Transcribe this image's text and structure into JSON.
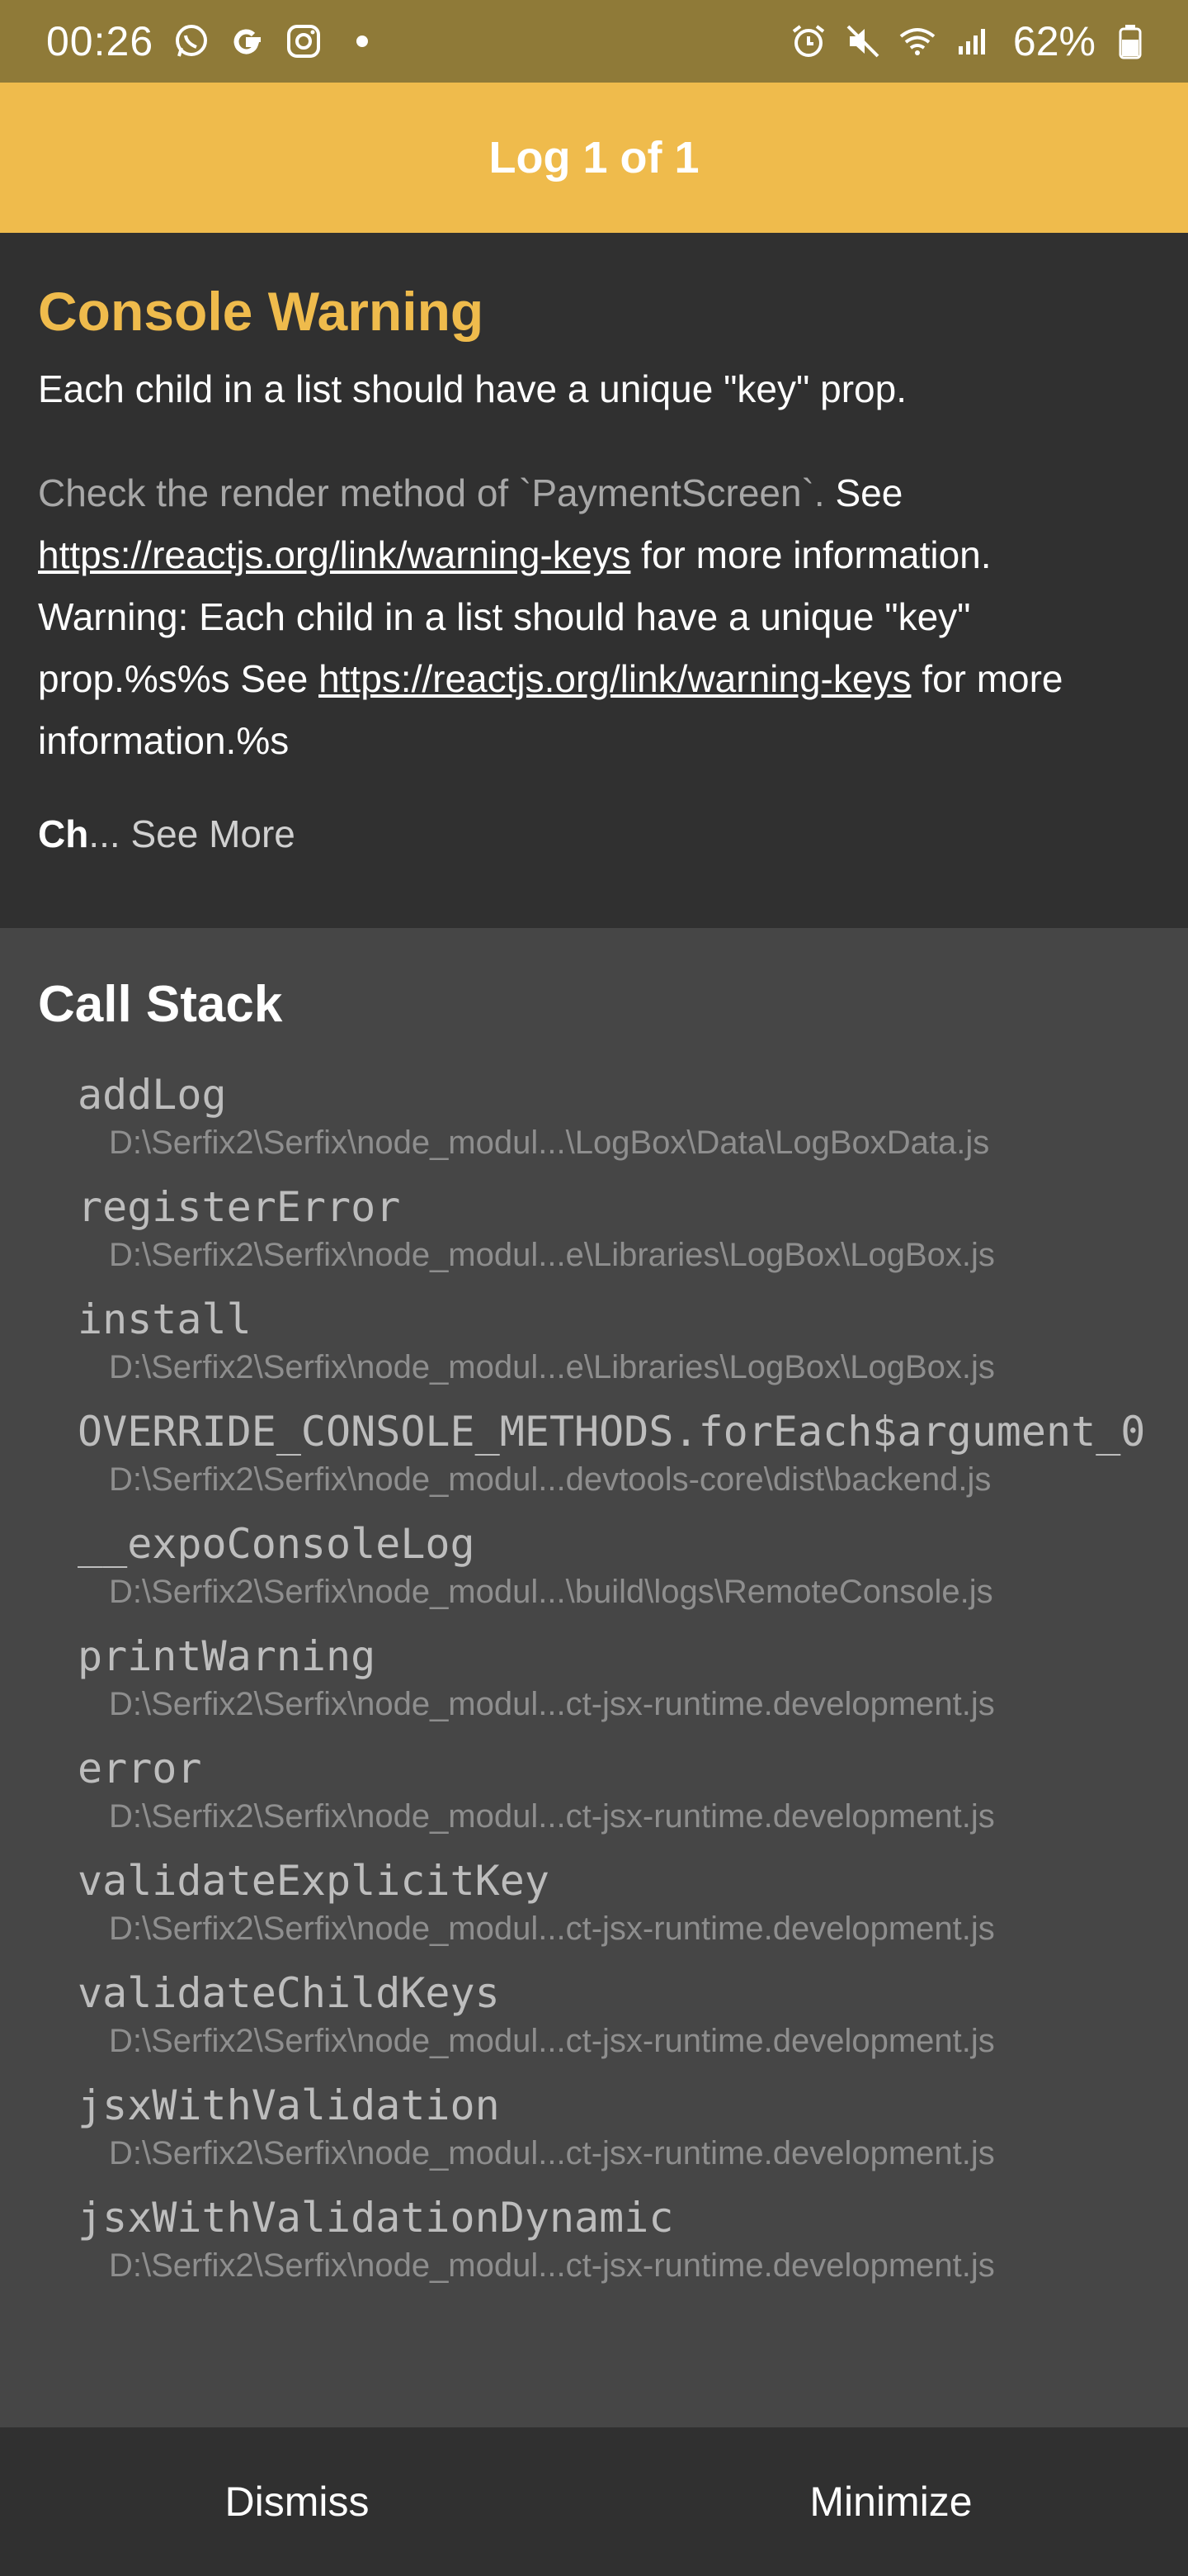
{
  "status_bar": {
    "time": "00:26",
    "battery": "62%",
    "left_icons": [
      "whatsapp-icon",
      "google-icon",
      "instagram-icon",
      "dot-icon"
    ],
    "right_icons": [
      "alarm-icon",
      "mute-icon",
      "wifi-icon",
      "signal-icon",
      "battery-icon"
    ]
  },
  "header": {
    "title": "Log 1 of 1"
  },
  "message": {
    "level": "Console Warning",
    "headline": "Each child in a list should have a unique \"key\" prop.",
    "body_muted": "Check the render method of `PaymentScreen`.",
    "body_see": " See ",
    "link": "https://reactjs.org/link/warning-keys",
    "body_after_link_1": " for more information.",
    "body_warning": "Warning: Each child in a list should have a unique \"key\" prop.%s%s See ",
    "body_after_link_2": " for more information.%s",
    "more_prefix": "Ch",
    "see_more": "... See More"
  },
  "call_stack": {
    "title": "Call Stack",
    "frames": [
      {
        "fn": "addLog",
        "file": "D:\\Serfix2\\Serfix\\node_modul...\\LogBox\\Data\\LogBoxData.js"
      },
      {
        "fn": "registerError",
        "file": "D:\\Serfix2\\Serfix\\node_modul...e\\Libraries\\LogBox\\LogBox.js"
      },
      {
        "fn": "install",
        "file": "D:\\Serfix2\\Serfix\\node_modul...e\\Libraries\\LogBox\\LogBox.js"
      },
      {
        "fn": "OVERRIDE_CONSOLE_METHODS.forEach$argument_0",
        "file": "D:\\Serfix2\\Serfix\\node_modul...devtools-core\\dist\\backend.js"
      },
      {
        "fn": "__expoConsoleLog",
        "file": "D:\\Serfix2\\Serfix\\node_modul...\\build\\logs\\RemoteConsole.js"
      },
      {
        "fn": "printWarning",
        "file": "D:\\Serfix2\\Serfix\\node_modul...ct-jsx-runtime.development.js"
      },
      {
        "fn": "error",
        "file": "D:\\Serfix2\\Serfix\\node_modul...ct-jsx-runtime.development.js"
      },
      {
        "fn": "validateExplicitKey",
        "file": "D:\\Serfix2\\Serfix\\node_modul...ct-jsx-runtime.development.js"
      },
      {
        "fn": "validateChildKeys",
        "file": "D:\\Serfix2\\Serfix\\node_modul...ct-jsx-runtime.development.js"
      },
      {
        "fn": "jsxWithValidation",
        "file": "D:\\Serfix2\\Serfix\\node_modul...ct-jsx-runtime.development.js"
      },
      {
        "fn": "jsxWithValidationDynamic",
        "file": "D:\\Serfix2\\Serfix\\node_modul...ct-jsx-runtime.development.js"
      }
    ]
  },
  "footer": {
    "dismiss": "Dismiss",
    "minimize": "Minimize"
  },
  "colors": {
    "accent": "#efbb4c",
    "message_bg": "#303030",
    "stack_bg": "#464646",
    "status_bg": "#8f7a38"
  }
}
